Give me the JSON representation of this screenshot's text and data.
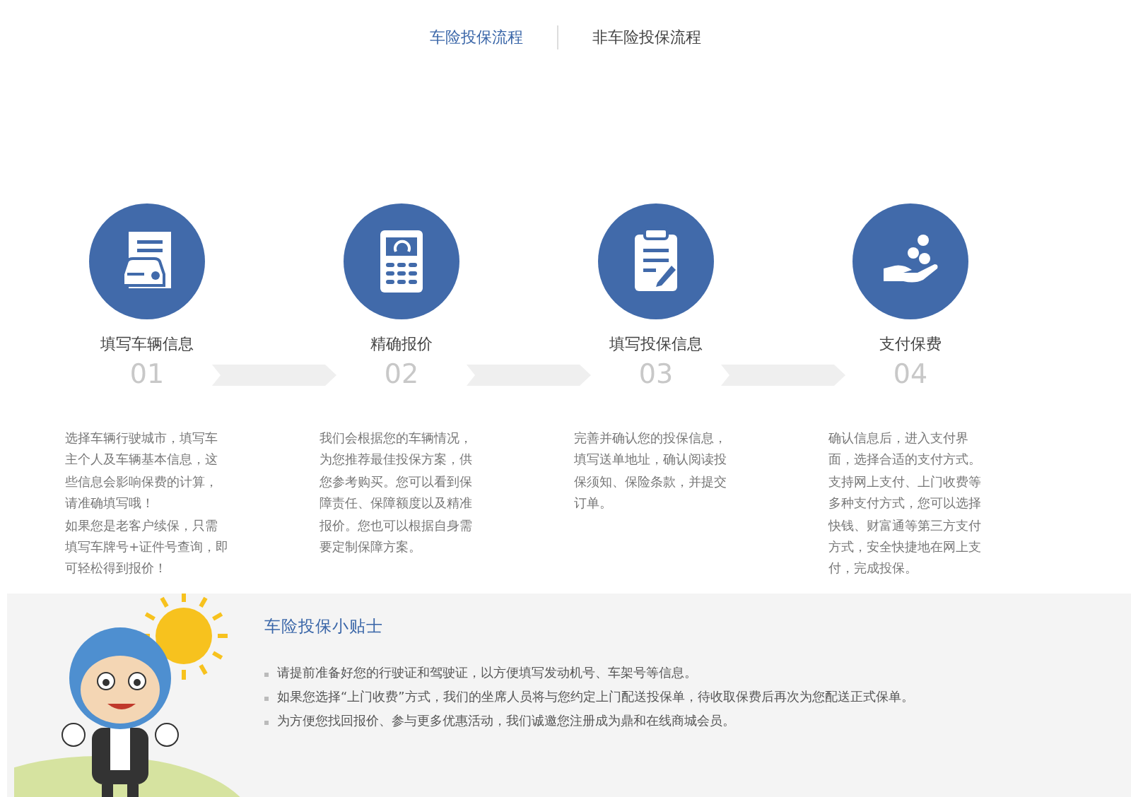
{
  "tabs": [
    {
      "label": "车险投保流程",
      "selected": true
    },
    {
      "label": "非车险投保流程",
      "selected": false
    }
  ],
  "steps": [
    {
      "title": "填写车辆信息",
      "number": "01",
      "description": [
        "选择车辆行驶城市，填写车主个人及车辆基本信息，这些信息会影响保费的计算，请准确填写哦！",
        "如果您是老客户续保，只需填写车牌号+证件号查询，即可轻松得到报价！"
      ]
    },
    {
      "title": "精确报价",
      "number": "02",
      "description": [
        "我们会根据您的车辆情况，为您推荐最佳投保方案，供您参考购买。您可以看到保障责任、保障额度以及精准报价。您也可以根据自身需要定制保障方案。"
      ]
    },
    {
      "title": "填写投保信息",
      "number": "03",
      "description": [
        "完善并确认您的投保信息，填写送单地址，确认阅读投保须知、保险条款，并提交订单。"
      ]
    },
    {
      "title": "支付保费",
      "number": "04",
      "description": [
        "确认信息后，进入支付界面，选择合适的支付方式。支持网上支付、上门收费等多种支付方式，您可以选择快钱、财富通等第三方支付方式，安全快捷地在网上支付，完成投保。"
      ]
    }
  ],
  "tips": {
    "title": "车险投保小贴士",
    "items": [
      "请提前准备好您的行驶证和驾驶证，以方便填写发动机号、车架号等信息。",
      "如果您选择“上门收费”方式，我们的坐席人员将与您约定上门配送投保单，待收取保费后再次为您配送正式保单。",
      "为方便您找回报价、参与更多优惠活动，我们诚邀您注册成为鼎和在线商城会员。"
    ]
  }
}
